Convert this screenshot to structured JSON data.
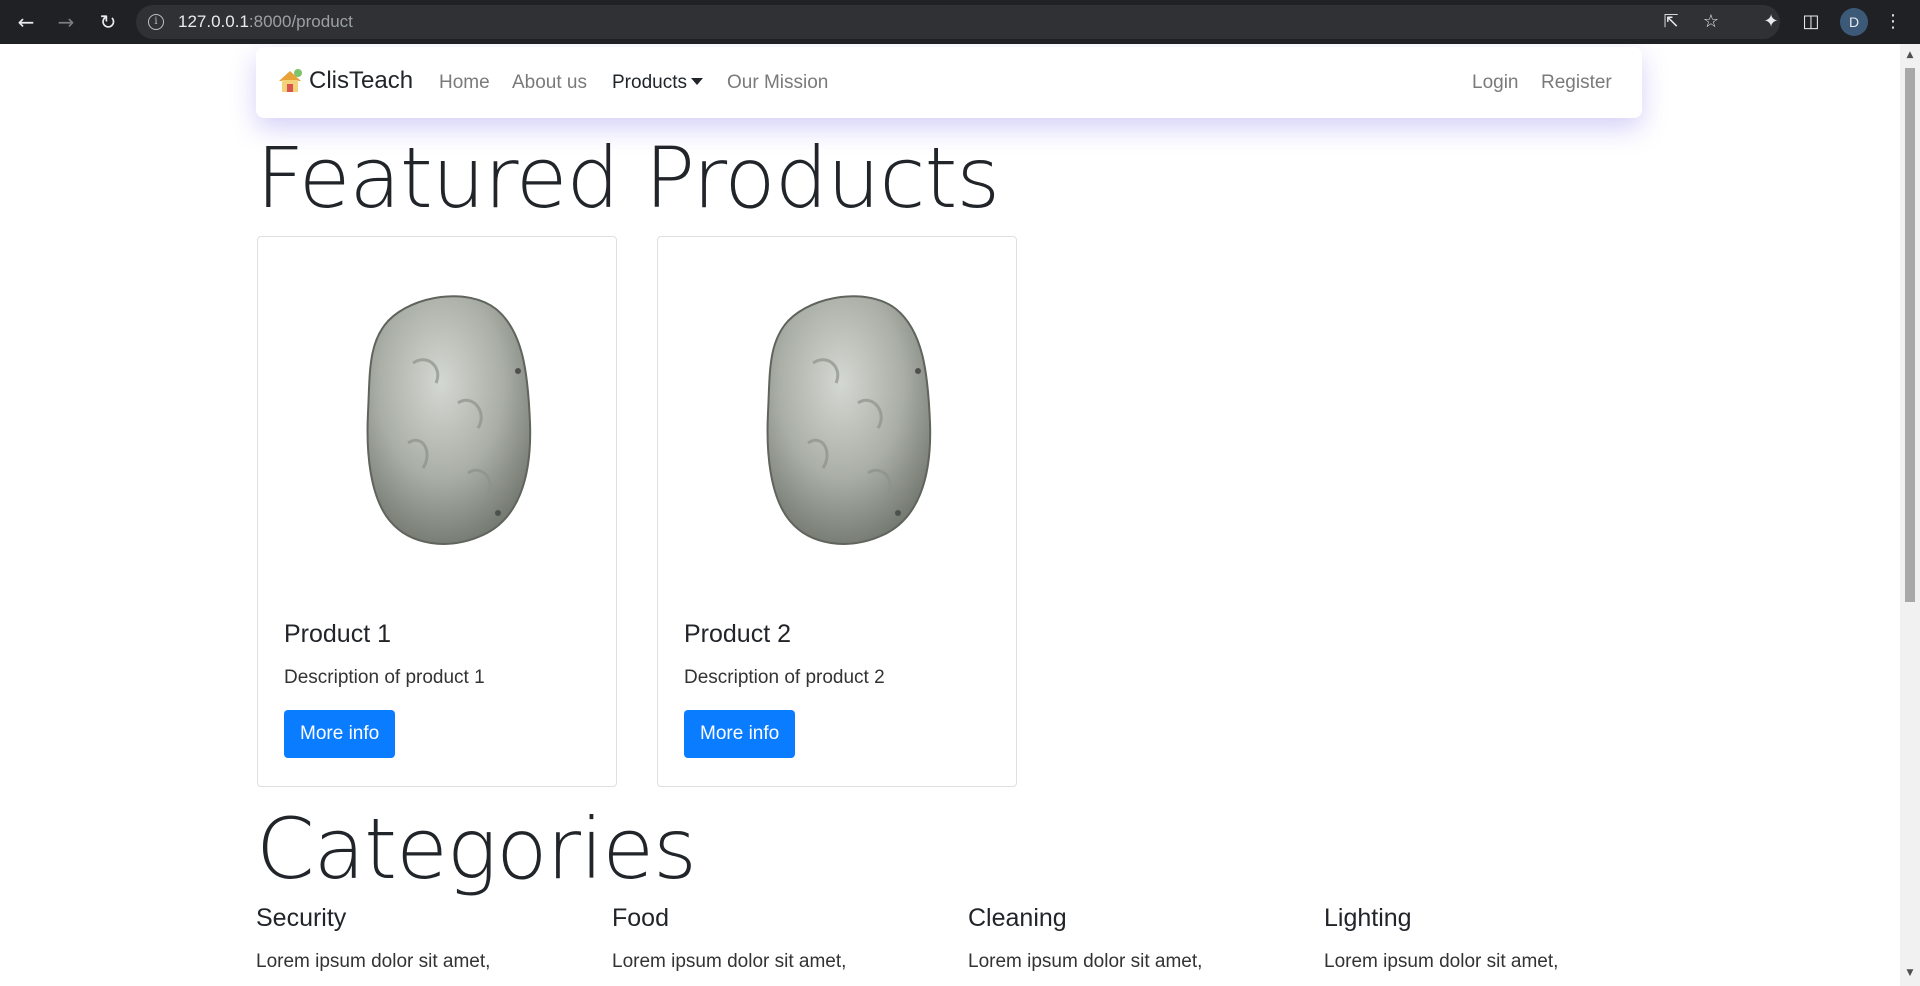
{
  "browser": {
    "url_host": "127.0.0.1",
    "url_path": ":8000/product",
    "profile_initial": "D",
    "icons": [
      "back-icon",
      "forward-icon",
      "reload-icon",
      "info-icon",
      "share-icon",
      "star-icon",
      "extensions-icon",
      "side-panel-icon",
      "menu-icon"
    ]
  },
  "navbar": {
    "brand": "ClisTeach",
    "links": [
      {
        "label": "Home",
        "active": false
      },
      {
        "label": "About us",
        "active": false
      },
      {
        "label": "Products",
        "active": true,
        "dropdown": true
      },
      {
        "label": "Our Mission",
        "active": false
      }
    ],
    "auth": [
      "Login",
      "Register"
    ]
  },
  "featured": {
    "heading": "Featured Products",
    "products": [
      {
        "title": "Product 1",
        "description": "Description of product 1",
        "button": "More info"
      },
      {
        "title": "Product 2",
        "description": "Description of product 2",
        "button": "More info"
      }
    ]
  },
  "categories": {
    "heading": "Categories",
    "items": [
      {
        "title": "Security",
        "text": "Lorem ipsum dolor sit amet,"
      },
      {
        "title": "Food",
        "text": "Lorem ipsum dolor sit amet,"
      },
      {
        "title": "Cleaning",
        "text": "Lorem ipsum dolor sit amet,"
      },
      {
        "title": "Lighting",
        "text": "Lorem ipsum dolor sit amet,"
      }
    ]
  },
  "colors": {
    "primary_button": "#0a7cff",
    "chrome_bg": "#202124",
    "navbar_shadow": "#786ee6"
  }
}
